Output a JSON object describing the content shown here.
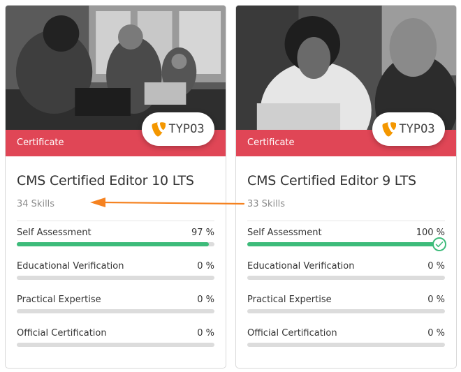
{
  "cards": [
    {
      "ribbon_label": "Certificate",
      "badge_text": "TYPO3",
      "title": "CMS Certified Editor 10 LTS",
      "skills": "34 Skills",
      "metrics": [
        {
          "label": "Self Assessment",
          "value": "97 %",
          "progress": 0.97,
          "complete": false
        },
        {
          "label": "Educational Verification",
          "value": "0 %",
          "progress": 0,
          "complete": false
        },
        {
          "label": "Practical Expertise",
          "value": "0 %",
          "progress": 0,
          "complete": false
        },
        {
          "label": "Official Certification",
          "value": "0 %",
          "progress": 0,
          "complete": false
        }
      ]
    },
    {
      "ribbon_label": "Certificate",
      "badge_text": "TYPO3",
      "title": "CMS Certified Editor 9 LTS",
      "skills": "33 Skills",
      "metrics": [
        {
          "label": "Self Assessment",
          "value": "100 %",
          "progress": 1.0,
          "complete": true
        },
        {
          "label": "Educational Verification",
          "value": "0 %",
          "progress": 0,
          "complete": false
        },
        {
          "label": "Practical Expertise",
          "value": "0 %",
          "progress": 0,
          "complete": false
        },
        {
          "label": "Official Certification",
          "value": "0 %",
          "progress": 0,
          "complete": false
        }
      ]
    }
  ],
  "colors": {
    "ribbon": "#e04656",
    "progress_fill": "#3dbb7a",
    "progress_track": "#dcdcdc",
    "typo3_orange": "#f49700",
    "annotation_arrow": "#f58220"
  },
  "icons": {
    "brand": "typo3-logo-icon",
    "complete": "check-circle-icon",
    "annotation": "arrow-left-icon"
  }
}
